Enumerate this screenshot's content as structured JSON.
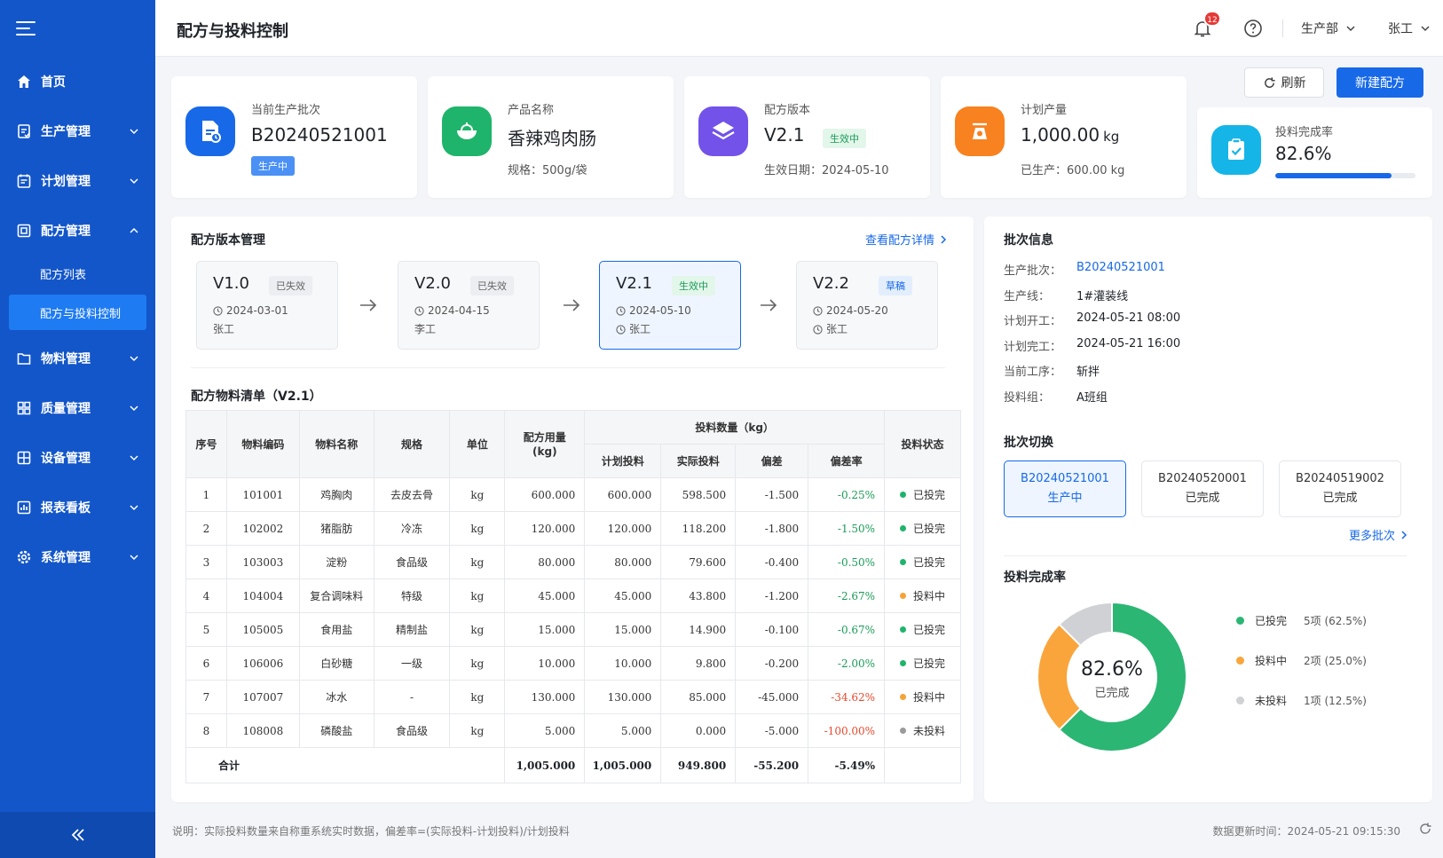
{
  "page_title": "配方与投料控制",
  "header": {
    "notification_count": "12",
    "department": "生产部",
    "user": "张工"
  },
  "sidebar": {
    "items": [
      {
        "label": "首页",
        "icon": "home-icon"
      },
      {
        "label": "生产管理",
        "icon": "production-icon"
      },
      {
        "label": "计划管理",
        "icon": "plan-icon"
      },
      {
        "label": "配方管理",
        "icon": "recipe-icon",
        "expanded": true
      },
      {
        "label": "物料管理",
        "icon": "material-icon"
      },
      {
        "label": "质量管理",
        "icon": "quality-icon"
      },
      {
        "label": "设备管理",
        "icon": "equipment-icon"
      },
      {
        "label": "报表看板",
        "icon": "report-icon"
      },
      {
        "label": "系统管理",
        "icon": "settings-icon"
      }
    ],
    "sub_items": [
      {
        "label": "配方列表"
      },
      {
        "label": "配方与投料控制",
        "active": true
      }
    ]
  },
  "toolbar": {
    "refresh_label": "刷新",
    "new_recipe_label": "新建配方"
  },
  "stats": {
    "batch": {
      "label": "当前生产批次",
      "value": "B20240521001",
      "tag": "生产中"
    },
    "product": {
      "label": "产品名称",
      "value": "香辣鸡肉肠",
      "sub": "规格：500g/袋"
    },
    "version": {
      "label": "配方版本",
      "value": "V2.1",
      "tag": "生效中",
      "sub": "生效日期：2024-05-10"
    },
    "output": {
      "label": "计划产量",
      "value": "1,000.00",
      "unit": "kg",
      "sub": "已生产：600.00 kg"
    },
    "completion": {
      "label": "投料完成率",
      "value": "82.6%",
      "fraction": 0.826
    }
  },
  "version_mgmt": {
    "title": "配方版本管理",
    "link": "查看配方详情",
    "versions": [
      {
        "name": "V1.0",
        "status": "已失效",
        "date": "2024-03-01",
        "author": "张工"
      },
      {
        "name": "V2.0",
        "status": "已失效",
        "date": "2024-04-15",
        "author": "李工"
      },
      {
        "name": "V2.1",
        "status": "生效中",
        "date": "2024-05-10",
        "author": "张工"
      },
      {
        "name": "V2.2",
        "status": "草稿",
        "date": "2024-05-20",
        "author": "张工"
      }
    ]
  },
  "bom": {
    "title": "配方物料清单（V2.1）",
    "headers": {
      "seq": "序号",
      "code": "物料编码",
      "name": "物料名称",
      "spec": "规格",
      "unit": "单位",
      "recipe_qty": "配方用量\n(kg)",
      "feed_group": "投料数量（kg）",
      "planned": "计划投料",
      "actual": "实际投料",
      "deviation": "偏差",
      "dev_rate": "偏差率",
      "status": "投料状态"
    },
    "rows": [
      {
        "seq": "1",
        "code": "101001",
        "name": "鸡胸肉",
        "spec": "去皮去骨",
        "unit": "kg",
        "recipe": "600.000",
        "planned": "600.000",
        "actual": "598.500",
        "dev": "-1.500",
        "rate": "-0.25%",
        "rate_color": "pos",
        "status": "已投完",
        "status_color": "#1fb46b"
      },
      {
        "seq": "2",
        "code": "102002",
        "name": "猪脂肪",
        "spec": "冷冻",
        "unit": "kg",
        "recipe": "120.000",
        "planned": "120.000",
        "actual": "118.200",
        "dev": "-1.800",
        "rate": "-1.50%",
        "rate_color": "pos",
        "status": "已投完",
        "status_color": "#1fb46b"
      },
      {
        "seq": "3",
        "code": "103003",
        "name": "淀粉",
        "spec": "食品级",
        "unit": "kg",
        "recipe": "80.000",
        "planned": "80.000",
        "actual": "79.600",
        "dev": "-0.400",
        "rate": "-0.50%",
        "rate_color": "pos",
        "status": "已投完",
        "status_color": "#1fb46b"
      },
      {
        "seq": "4",
        "code": "104004",
        "name": "复合调味料",
        "spec": "特级",
        "unit": "kg",
        "recipe": "45.000",
        "planned": "45.000",
        "actual": "43.800",
        "dev": "-1.200",
        "rate": "-2.67%",
        "rate_color": "pos",
        "status": "投料中",
        "status_color": "#f7a237"
      },
      {
        "seq": "5",
        "code": "105005",
        "name": "食用盐",
        "spec": "精制盐",
        "unit": "kg",
        "recipe": "15.000",
        "planned": "15.000",
        "actual": "14.900",
        "dev": "-0.100",
        "rate": "-0.67%",
        "rate_color": "pos",
        "status": "已投完",
        "status_color": "#1fb46b"
      },
      {
        "seq": "6",
        "code": "106006",
        "name": "白砂糖",
        "spec": "一级",
        "unit": "kg",
        "recipe": "10.000",
        "planned": "10.000",
        "actual": "9.800",
        "dev": "-0.200",
        "rate": "-2.00%",
        "rate_color": "pos",
        "status": "已投完",
        "status_color": "#1fb46b"
      },
      {
        "seq": "7",
        "code": "107007",
        "name": "冰水",
        "spec": "-",
        "unit": "kg",
        "recipe": "130.000",
        "planned": "130.000",
        "actual": "85.000",
        "dev": "-45.000",
        "rate": "-34.62%",
        "rate_color": "neg",
        "status": "投料中",
        "status_color": "#f7a237"
      },
      {
        "seq": "8",
        "code": "108008",
        "name": "磷酸盐",
        "spec": "食品级",
        "unit": "kg",
        "recipe": "5.000",
        "planned": "5.000",
        "actual": "0.000",
        "dev": "-5.000",
        "rate": "-100.00%",
        "rate_color": "neg",
        "status": "未投料",
        "status_color": "#9a9a9a"
      }
    ],
    "total": {
      "label": "合计",
      "recipe": "1,005.000",
      "planned": "1,005.000",
      "actual": "949.800",
      "dev": "-55.200",
      "rate": "-5.49%"
    }
  },
  "batch_info": {
    "title": "批次信息",
    "rows": [
      {
        "k": "生产批次：",
        "v": "B20240521001",
        "link": true
      },
      {
        "k": "生产线：",
        "v": "1#灌装线"
      },
      {
        "k": "计划开工：",
        "v": "2024-05-21 08:00"
      },
      {
        "k": "计划完工：",
        "v": "2024-05-21 16:00"
      },
      {
        "k": "当前工序：",
        "v": "斩拌"
      },
      {
        "k": "投料组：",
        "v": "A班组"
      }
    ]
  },
  "batch_switch": {
    "title": "批次切换",
    "items": [
      {
        "id": "B20240521001",
        "status": "生产中",
        "active": true
      },
      {
        "id": "B20240520001",
        "status": "已完成"
      },
      {
        "id": "B20240519002",
        "status": "已完成"
      }
    ],
    "more": "更多批次"
  },
  "donut": {
    "title": "投料完成率",
    "center_value": "82.6%",
    "center_label": "已完成",
    "segments": [
      {
        "name": "已投完",
        "value": "5项 (62.5%)",
        "share": 0.625,
        "color": "#2bb673"
      },
      {
        "name": "投料中",
        "value": "2项 (25.0%)",
        "share": 0.25,
        "color": "#f9a53c"
      },
      {
        "name": "未投料",
        "value": "1项 (12.5%)",
        "share": 0.125,
        "color": "#cfd1d4"
      }
    ]
  },
  "footer": {
    "note": "说明：实际投料数量来自称重系统实时数据，偏差率=(实际投料-计划投料)/计划投料",
    "time": "数据更新时间：2024-05-21 09:15:30"
  },
  "colors": {
    "primary": "#1769e8",
    "sidebar": "#1356c9",
    "success": "#1fb46b",
    "warning": "#f7a237",
    "danger": "#e64a2e"
  }
}
